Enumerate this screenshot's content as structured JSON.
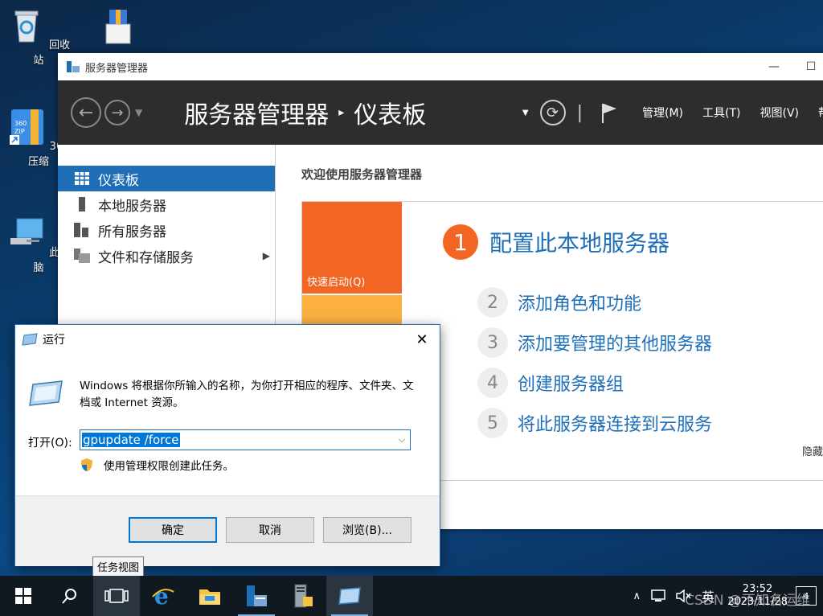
{
  "desktop": {
    "icons": [
      {
        "label": "回收站"
      },
      {
        "label": ""
      },
      {
        "label": "360压缩"
      },
      {
        "label": "此电脑"
      }
    ]
  },
  "server_manager": {
    "window_title": "服务器管理器",
    "breadcrumb_root": "服务器管理器",
    "breadcrumb_current": "仪表板",
    "menus": {
      "manage": "管理(M)",
      "tools": "工具(T)",
      "view": "视图(V)",
      "help": "帮"
    },
    "sidebar": [
      {
        "label": "仪表板",
        "active": true
      },
      {
        "label": "本地服务器"
      },
      {
        "label": "所有服务器"
      },
      {
        "label": "文件和存储服务"
      }
    ],
    "welcome": "欢迎使用服务器管理器",
    "quick_start_label": "快速启动(Q)",
    "step1": {
      "num": "1",
      "text": "配置此本地服务器"
    },
    "steps": [
      {
        "num": "2",
        "text": "添加角色和功能"
      },
      {
        "num": "3",
        "text": "添加要管理的其他服务器"
      },
      {
        "num": "4",
        "text": "创建服务器组"
      },
      {
        "num": "5",
        "text": "将此服务器连接到云服务"
      }
    ],
    "hide_label": "隐藏"
  },
  "run_dialog": {
    "title": "运行",
    "description": "Windows 将根据你所输入的名称，为你打开相应的程序、文件夹、文档或 Internet 资源。",
    "open_label": "打开(O):",
    "input_value": "gpupdate /force",
    "admin_note": "使用管理权限创建此任务。",
    "buttons": {
      "ok": "确定",
      "cancel": "取消",
      "browse": "浏览(B)..."
    }
  },
  "tooltip": "任务视图",
  "taskbar": {
    "ime": "英",
    "time": "23:52",
    "date": "2023/11/28",
    "notification_count": "4"
  },
  "watermark": "CSDN @不知名运维"
}
